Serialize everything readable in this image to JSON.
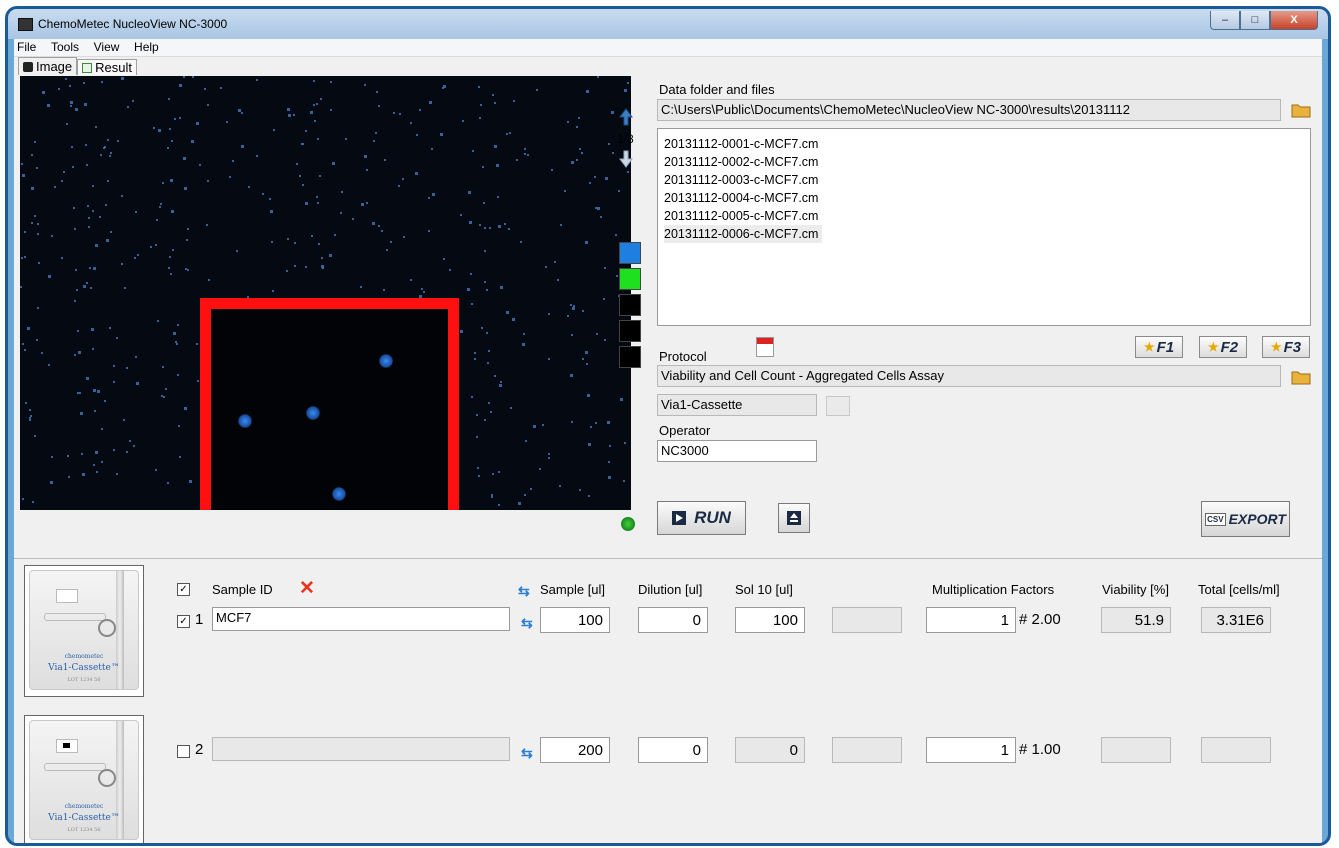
{
  "window": {
    "title": "ChemoMetec NucleoView NC-3000",
    "minimize": "–",
    "maximize": "□",
    "close": "X"
  },
  "menu": [
    "File",
    "Tools",
    "View",
    "Help"
  ],
  "tabs": {
    "image": "Image",
    "result": "Result"
  },
  "image_nav": {
    "page": "1/8"
  },
  "channels": {
    "colors": [
      "#1e7fe0",
      "#1ee01e",
      "#000000",
      "#000000",
      "#000000"
    ]
  },
  "data_folder": {
    "label": "Data folder and files",
    "path": "C:\\Users\\Public\\Documents\\ChemoMetec\\NucleoView NC-3000\\results\\20131112",
    "files": [
      "20131112-0001-c-MCF7.cm",
      "20131112-0002-c-MCF7.cm",
      "20131112-0003-c-MCF7.cm",
      "20131112-0004-c-MCF7.cm",
      "20131112-0005-c-MCF7.cm",
      "20131112-0006-c-MCF7.cm"
    ]
  },
  "fkeys": [
    "F1",
    "F2",
    "F3"
  ],
  "protocol": {
    "label": "Protocol",
    "value": "Viability and Cell Count - Aggregated Cells Assay",
    "cassette": "Via1-Cassette"
  },
  "operator": {
    "label": "Operator",
    "value": "NC3000"
  },
  "actions": {
    "run": "RUN",
    "export": "EXPORT",
    "csv": "CSV"
  },
  "headers": {
    "sample_id": "Sample ID",
    "sample": "Sample [ul]",
    "dilution": "Dilution [ul]",
    "sol10": "Sol 10 [ul]",
    "mult": "Multiplication Factors",
    "viability": "Viability [%]",
    "total": "Total [cells/ml]"
  },
  "rows": [
    {
      "num": "1",
      "checked": true,
      "sample_id": "MCF7",
      "sample": "100",
      "dilution": "0",
      "sol10": "100",
      "blank": "",
      "mult": "1",
      "mult_suffix": "# 2.00",
      "viability": "51.9",
      "total": "3.31E6"
    },
    {
      "num": "2",
      "checked": false,
      "sample_id": "",
      "sample": "200",
      "dilution": "0",
      "sol10": "0",
      "blank": "",
      "mult": "1",
      "mult_suffix": "# 1.00",
      "viability": "",
      "total": ""
    }
  ],
  "cassette_img": {
    "brand": "chemometec",
    "name": "Via1-Cassette™",
    "lot": "LOT 1234 56"
  }
}
